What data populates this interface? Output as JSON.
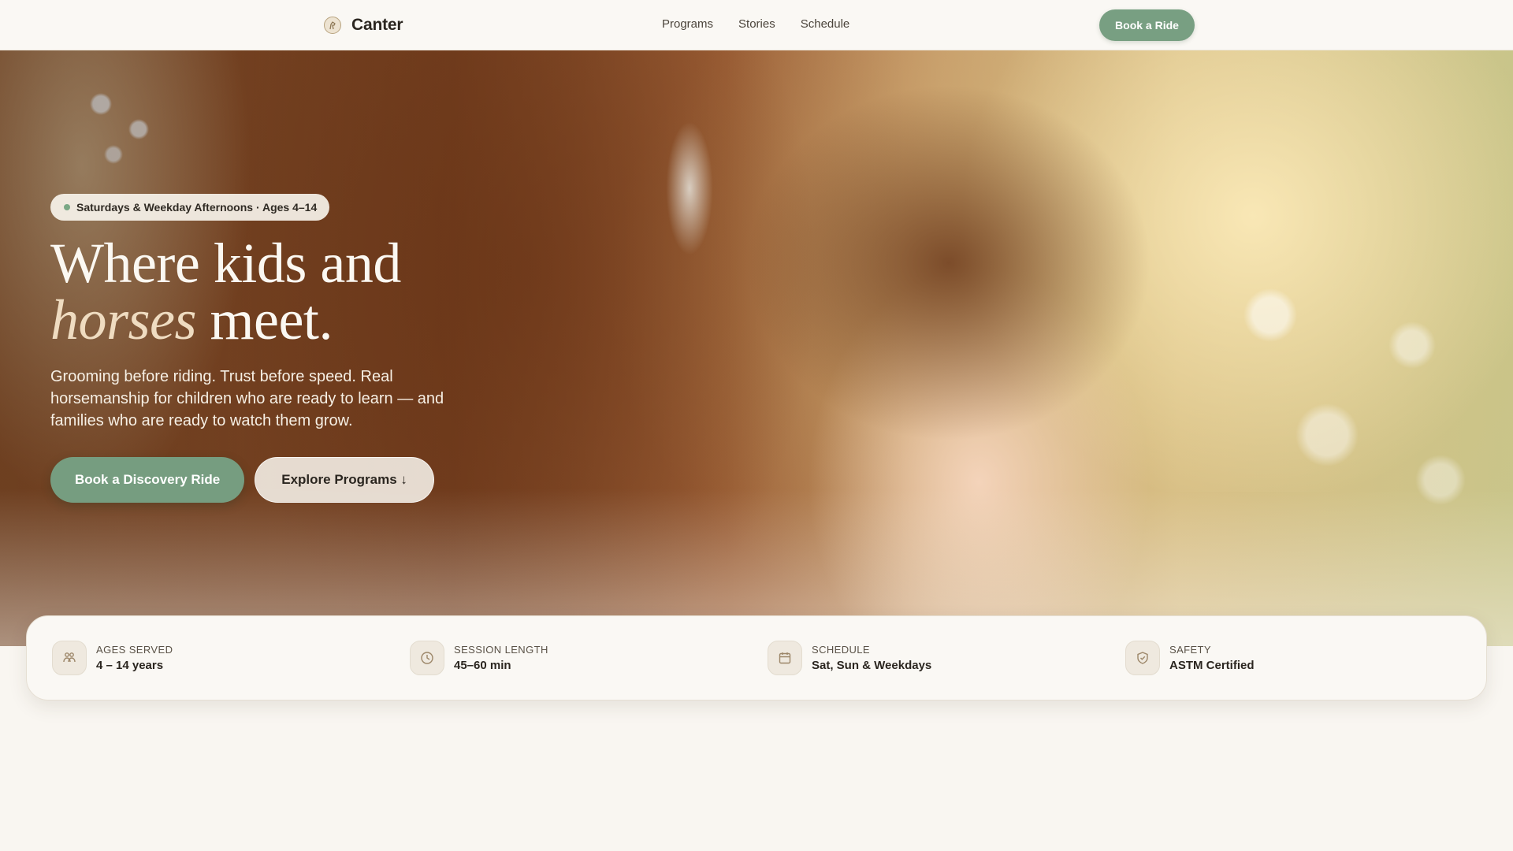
{
  "brand": {
    "name": "Canter",
    "logo_icon": "horse-logo-icon"
  },
  "nav": {
    "items": [
      {
        "label": "Programs"
      },
      {
        "label": "Stories"
      },
      {
        "label": "Schedule"
      }
    ],
    "cta_label": "Book a Ride"
  },
  "hero": {
    "badge": "Saturdays & Weekday Afternoons · Ages 4–14",
    "headline": {
      "line1": "Where kids and",
      "line2_em": "horses",
      "line2_rest": " meet."
    },
    "subcopy": "Grooming before riding. Trust before speed. Real horsemanship for children who are ready to learn — and families who are ready to watch them grow.",
    "primary_cta": "Book a Discovery Ride",
    "secondary_cta": "Explore Programs ↓"
  },
  "stats": [
    {
      "label": "AGES SERVED",
      "value": "4 – 14 years",
      "icon": "children-icon"
    },
    {
      "label": "SESSION LENGTH",
      "value": "45–60 min",
      "icon": "clock-icon"
    },
    {
      "label": "SCHEDULE",
      "value": "Sat, Sun & Weekdays",
      "icon": "calendar-icon"
    },
    {
      "label": "SAFETY",
      "value": "ASTM Certified",
      "icon": "shield-check-icon"
    }
  ],
  "colors": {
    "accent": "#769d80",
    "background": "#f9f6f1",
    "text": "#2b2620",
    "headline_em": "#efdcc1"
  }
}
